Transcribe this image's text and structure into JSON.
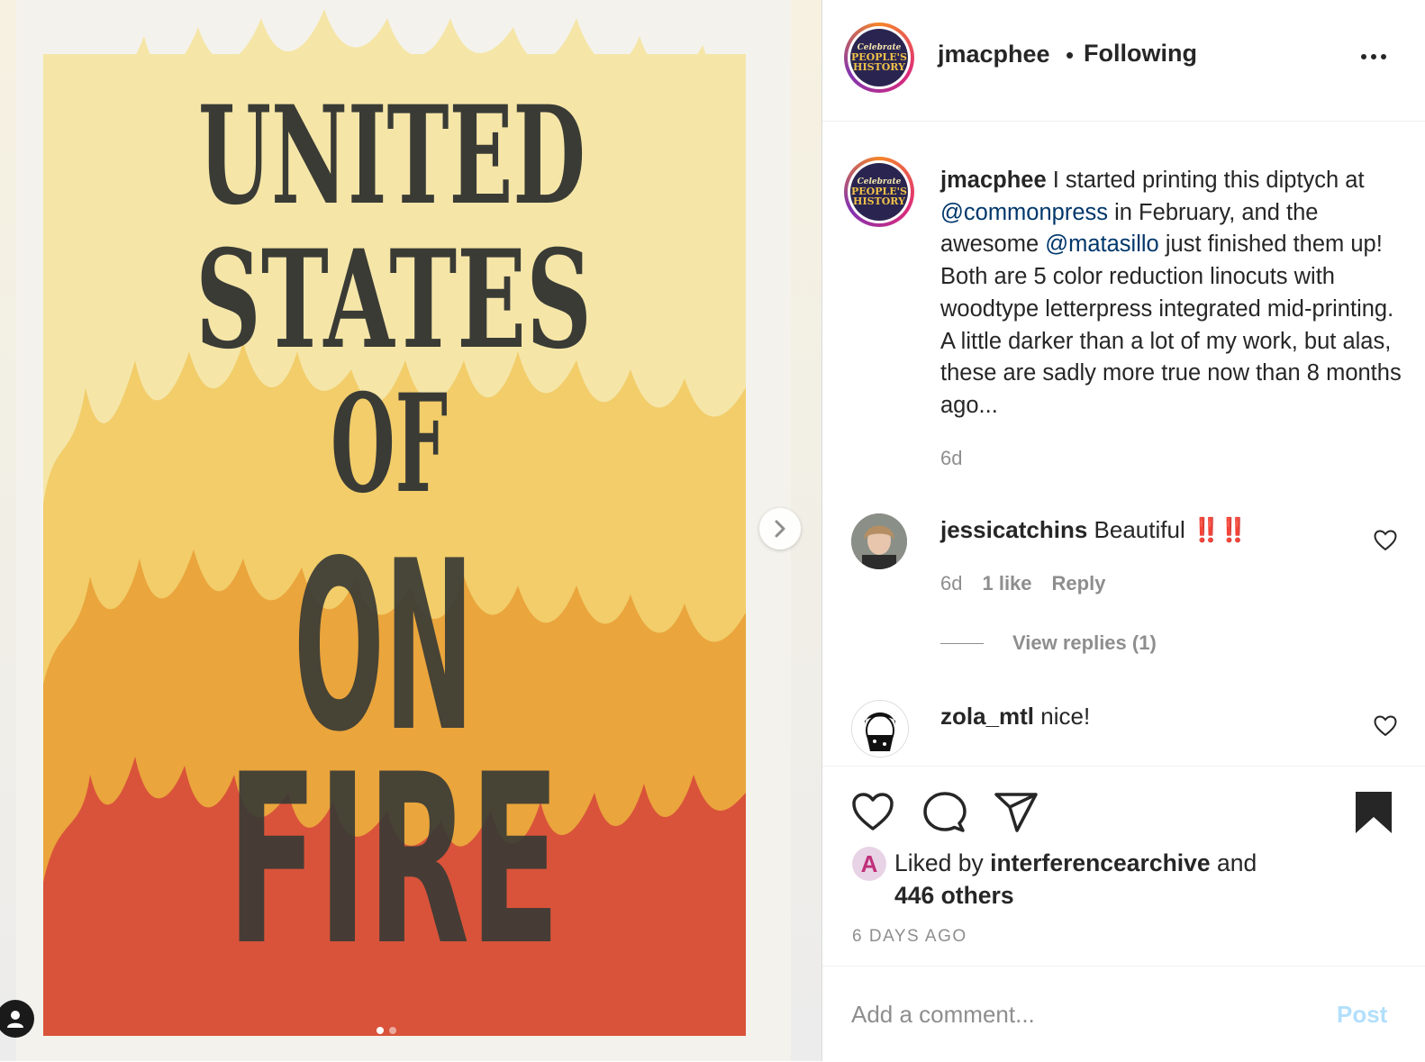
{
  "media": {
    "poster_text": [
      "UNITED",
      "STATES",
      "OF",
      "ON",
      "FIRE"
    ],
    "slide_index": 1,
    "slide_count": 2,
    "colors": {
      "light_yellow": "#f5e6a8",
      "yellow": "#f2cd6a",
      "orange": "#eaa53c",
      "red": "#d9533a",
      "ink": "#3a3b35"
    }
  },
  "header": {
    "avatar_lines": [
      "Celebrate",
      "PEOPLE'S",
      "HISTORY"
    ],
    "username": "jmacphee",
    "separator": "•",
    "follow_status": "Following",
    "more_icon": "more-horizontal-icon"
  },
  "caption": {
    "username": "jmacphee",
    "part1": "I started printing this diptych at",
    "mention1": "@commonpress",
    "part2": "in February, and the awesome",
    "mention2": "@matasillo",
    "part3": "just finished them up! Both are 5 color reduction linocuts with woodtype letterpress integrated mid-printing. A little darker than a lot of my work, but alas, these are sadly more true now than 8 months ago...",
    "time": "6d"
  },
  "comments": [
    {
      "username": "jessicatchins",
      "text": "Beautiful",
      "emoji": "‼️‼️",
      "time": "6d",
      "likes": "1 like",
      "reply_label": "Reply",
      "view_replies": "View replies (1)"
    },
    {
      "username": "zola_mtl",
      "text": "nice!"
    }
  ],
  "likes": {
    "prefix": "Liked by",
    "user": "interferencearchive",
    "conj": "and",
    "others": "446 others"
  },
  "date": "6 DAYS AGO",
  "comment_box": {
    "placeholder": "Add a comment...",
    "post_label": "Post"
  },
  "accent_colors": {
    "link": "#00376b",
    "post_disabled": "#b2dffc",
    "secondary_text": "#8e8e8e"
  }
}
